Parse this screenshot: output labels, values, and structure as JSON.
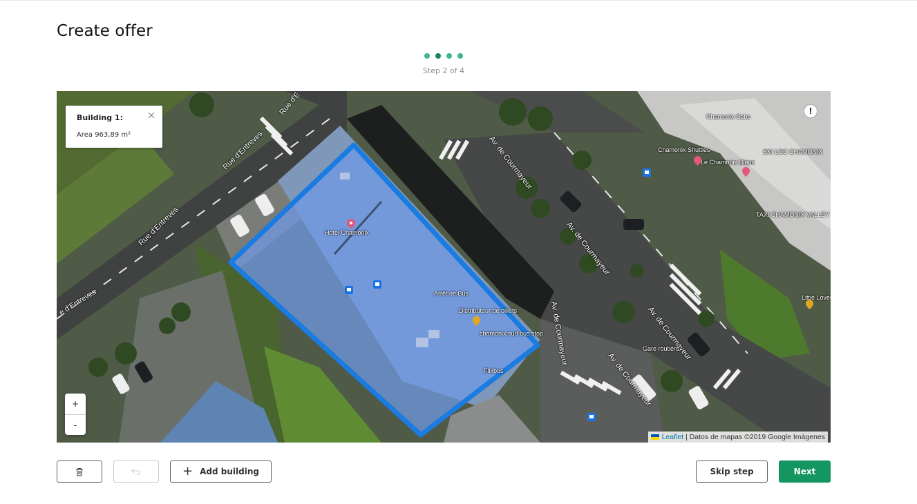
{
  "header": {
    "title": "Create offer"
  },
  "stepper": {
    "label": "Step 2 of 4",
    "current": 2,
    "total": 4
  },
  "map": {
    "info_box": {
      "title": "Building 1:",
      "area": "Area 963,89 m²"
    },
    "zoom": {
      "in": "+",
      "out": "-"
    },
    "warning_glyph": "!",
    "attribution": {
      "link": "Leaflet",
      "text": " | Datos de mapas ©2019 Google Imágenes"
    },
    "streets": [
      "Rue d'Entreves",
      "Rue d'Entreves",
      "e d'Entreves",
      "Rue d'E",
      "Av. de Courmayeur",
      "Av. de Courmayeur",
      "Av. de Courmayeur",
      "Av. de Courmayeur",
      "Av. de Courmayeur"
    ],
    "places": [
      "Chamonix Cabs",
      "Chamonix Shuttles",
      "Le Chamonix Blanc",
      "SKI LOC CHAMONIX",
      "TAXI CHAMONIX VALLEY",
      "Little Lovers",
      "Hotel Chamonix",
      "Arrêt de Bus",
      "Distributeur de billets",
      "chamonix sud bus stop",
      "Flixbus",
      "Gare routière"
    ],
    "icons": [
      "pin-icon",
      "bus-stop-icon",
      "hotel-icon"
    ],
    "colors": {
      "polygon_stroke": "#1a7be0",
      "polygon_fill": "#6f9ae8"
    }
  },
  "toolbar": {
    "delete_icon": "trash-icon",
    "undo_icon": "undo-icon",
    "add_building": "Add building",
    "skip_step": "Skip step",
    "next": "Next"
  },
  "colors": {
    "accent": "#13965f",
    "step_dot": "#3fb887",
    "step_dot_active": "#13885a"
  }
}
